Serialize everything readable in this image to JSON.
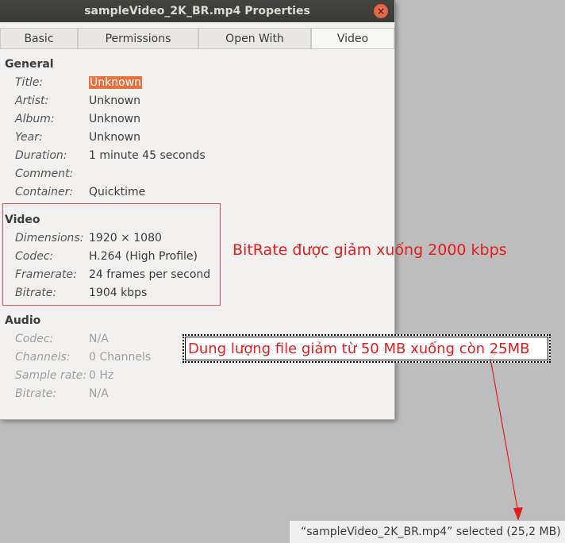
{
  "window": {
    "title": "sampleVideo_2K_BR.mp4 Properties",
    "close_glyph": "×"
  },
  "tabs": [
    {
      "label": "Basic"
    },
    {
      "label": "Permissions"
    },
    {
      "label": "Open With"
    },
    {
      "label": "Video"
    }
  ],
  "sections": {
    "general": {
      "title": "General",
      "rows": [
        {
          "label": "Title:",
          "value": "Unknown"
        },
        {
          "label": "Artist:",
          "value": "Unknown"
        },
        {
          "label": "Album:",
          "value": "Unknown"
        },
        {
          "label": "Year:",
          "value": "Unknown"
        },
        {
          "label": "Duration:",
          "value": "1 minute 45 seconds"
        },
        {
          "label": "Comment:",
          "value": ""
        },
        {
          "label": "Container:",
          "value": "Quicktime"
        }
      ]
    },
    "video": {
      "title": "Video",
      "rows": [
        {
          "label": "Dimensions:",
          "value": "1920 × 1080"
        },
        {
          "label": "Codec:",
          "value": "H.264 (High Profile)"
        },
        {
          "label": "Framerate:",
          "value": "24 frames per second"
        },
        {
          "label": "Bitrate:",
          "value": "1904 kbps"
        }
      ]
    },
    "audio": {
      "title": "Audio",
      "rows": [
        {
          "label": "Codec:",
          "value": "N/A"
        },
        {
          "label": "Channels:",
          "value": "0 Channels"
        },
        {
          "label": "Sample rate:",
          "value": "0 Hz"
        },
        {
          "label": "Bitrate:",
          "value": "N/A"
        }
      ]
    }
  },
  "annotations": {
    "bitrate_note": "BitRate được giảm xuống 2000 kbps",
    "size_note": "Dung lượng file giảm từ 50 MB xuống còn 25MB"
  },
  "statusbar": {
    "text": "“sampleVideo_2K_BR.mp4” selected  (25,2 MB)"
  },
  "colors": {
    "annotation": "#e31d1d",
    "selection": "#e9703f",
    "titlebar": "#3c3b37"
  }
}
